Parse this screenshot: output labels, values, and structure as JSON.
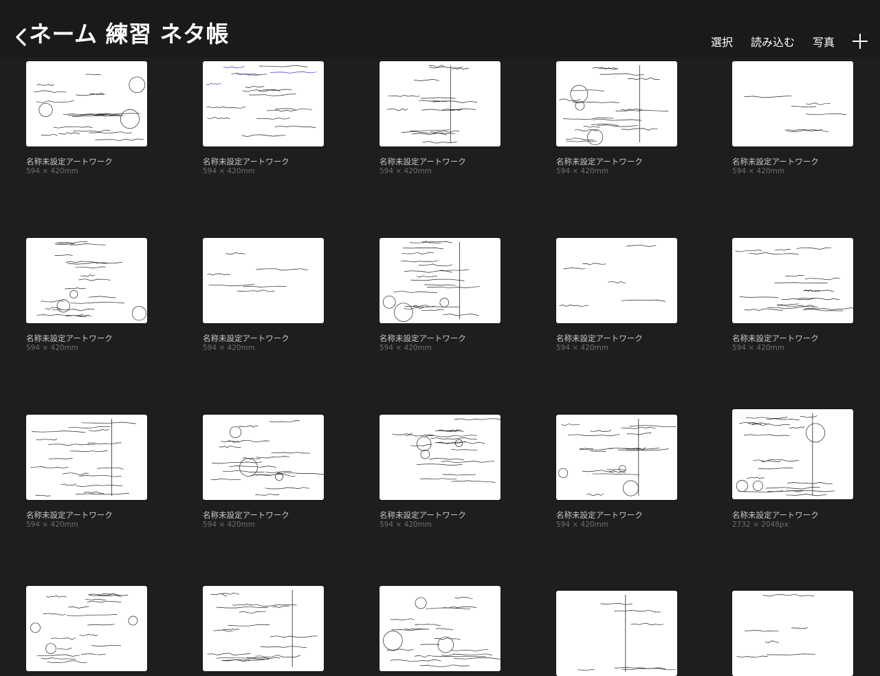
{
  "header": {
    "title": "ネーム 練習 ネタ帳",
    "actions": {
      "select": "選択",
      "import": "読み込む",
      "photo": "写真"
    },
    "icons": {
      "back": "chevron-left-icon",
      "add": "plus-icon"
    }
  },
  "gallery": {
    "items": [
      {
        "name": "名称未設定アートワーク",
        "size": "594 × 420mm"
      },
      {
        "name": "名称未設定アートワーク",
        "size": "594 × 420mm"
      },
      {
        "name": "名称未設定アートワーク",
        "size": "594 × 420mm"
      },
      {
        "name": "名称未設定アートワーク",
        "size": "594 × 420mm"
      },
      {
        "name": "名称未設定アートワーク",
        "size": "594 × 420mm"
      },
      {
        "name": "名称未設定アートワーク",
        "size": "594 × 420mm"
      },
      {
        "name": "名称未設定アートワーク",
        "size": "594 × 420mm"
      },
      {
        "name": "名称未設定アートワーク",
        "size": "594 × 420mm"
      },
      {
        "name": "名称未設定アートワーク",
        "size": "594 × 420mm"
      },
      {
        "name": "名称未設定アートワーク",
        "size": "594 × 420mm"
      },
      {
        "name": "名称未設定アートワーク",
        "size": "594 × 420mm"
      },
      {
        "name": "名称未設定アートワーク",
        "size": "594 × 420mm"
      },
      {
        "name": "名称未設定アートワーク",
        "size": "594 × 420mm"
      },
      {
        "name": "名称未設定アートワーク",
        "size": "594 × 420mm"
      },
      {
        "name": "名称未設定アートワーク",
        "size": "2732 × 2048px"
      },
      {
        "name": "",
        "size": ""
      },
      {
        "name": "",
        "size": ""
      },
      {
        "name": "",
        "size": ""
      },
      {
        "name": "",
        "size": ""
      },
      {
        "name": "",
        "size": ""
      }
    ]
  },
  "colors": {
    "background": "#1e1e1e",
    "header": "#1a1a1a",
    "caption": "#c8c8c8",
    "subcaption": "#6e6e6e"
  }
}
